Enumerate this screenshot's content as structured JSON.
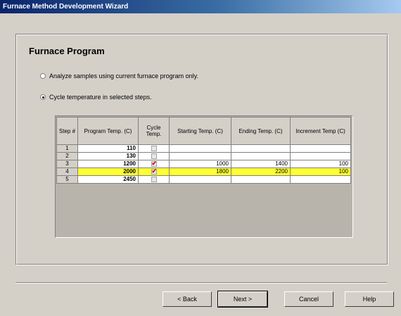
{
  "window": {
    "title": "Furnace Method Development Wizard"
  },
  "page": {
    "title": "Furnace Program",
    "options": [
      {
        "label": "Analyze samples using current furnace program only.",
        "selected": false
      },
      {
        "label": "Cycle temperature in selected steps.",
        "selected": true
      }
    ]
  },
  "table": {
    "headers": [
      "Step #",
      "Program Temp. (C)",
      "Cycle Temp.",
      "Starting Temp. (C)",
      "Ending Temp. (C)",
      "Increment Temp (C)"
    ],
    "rows": [
      {
        "step": "1",
        "program_temp": "110",
        "cycle": false,
        "start": "",
        "end": "",
        "increment": "",
        "highlight": false
      },
      {
        "step": "2",
        "program_temp": "130",
        "cycle": false,
        "start": "",
        "end": "",
        "increment": "",
        "highlight": false
      },
      {
        "step": "3",
        "program_temp": "1200",
        "cycle": true,
        "start": "1000",
        "end": "1400",
        "increment": "100",
        "highlight": false
      },
      {
        "step": "4",
        "program_temp": "2000",
        "cycle": true,
        "start": "1800",
        "end": "2200",
        "increment": "100",
        "highlight": true
      },
      {
        "step": "5",
        "program_temp": "2450",
        "cycle": false,
        "start": "",
        "end": "",
        "increment": "",
        "highlight": false
      }
    ]
  },
  "buttons": {
    "back": "< Back",
    "next": "Next >",
    "cancel": "Cancel",
    "help": "Help"
  },
  "colors": {
    "titlebar": "#0a246a",
    "highlight_row": "#ffff33",
    "check_mark": "#d01010"
  }
}
